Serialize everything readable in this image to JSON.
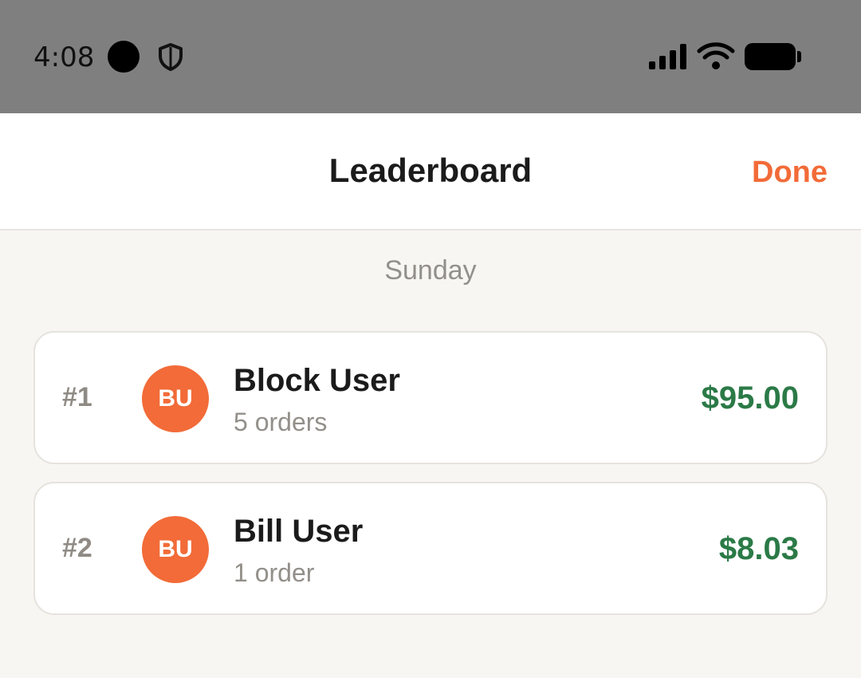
{
  "status_bar": {
    "time": "4:08",
    "icons": [
      "record-dot-icon",
      "shield-icon",
      "cell-signal-icon",
      "wifi-icon",
      "battery-icon"
    ]
  },
  "header": {
    "title": "Leaderboard",
    "done_label": "Done"
  },
  "day_label": "Sunday",
  "colors": {
    "accent": "#f26b38",
    "amount": "#2b7a47",
    "muted": "#938f8a"
  },
  "leaders": [
    {
      "rank": "#1",
      "initials": "BU",
      "name": "Block User",
      "orders": "5 orders",
      "amount": "$95.00"
    },
    {
      "rank": "#2",
      "initials": "BU",
      "name": "Bill User",
      "orders": "1 order",
      "amount": "$8.03"
    }
  ]
}
